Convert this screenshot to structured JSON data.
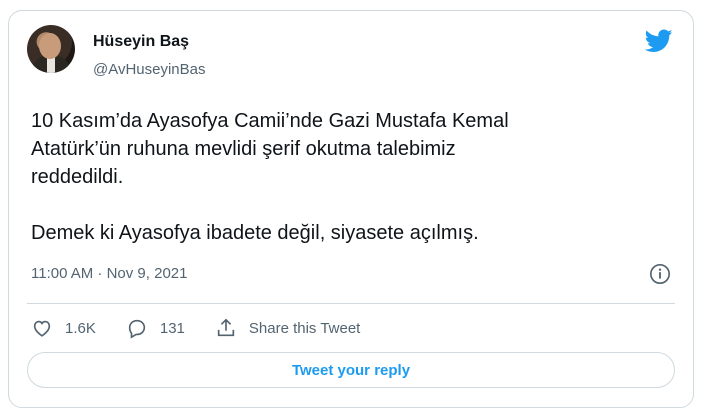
{
  "author": {
    "name": "Hüseyin Baş",
    "handle": "@AvHuseyinBas"
  },
  "tweet": {
    "text": "10 Kasım’da Ayasofya Camii’nde Gazi Mustafa Kemal\nAtatürk’ün ruhuna mevlidi şerif okutma talebimiz\nreddedildi.\n\nDemek ki Ayasofya ibadete değil, siyasete açılmış.",
    "timestamp": "11:00 AM · Nov 9, 2021"
  },
  "actions": {
    "likes": "1.6K",
    "replies": "131",
    "share_label": "Share this Tweet",
    "reply_button_label": "Tweet your reply"
  },
  "icons": {
    "brand": "twitter-bird-icon",
    "info": "info-icon",
    "like": "heart-icon",
    "reply": "reply-bubble-icon",
    "share": "share-icon"
  },
  "colors": {
    "brand": "#1d9bf0",
    "text": "#0f1419",
    "secondary": "#536471",
    "border": "#cfd9de"
  }
}
